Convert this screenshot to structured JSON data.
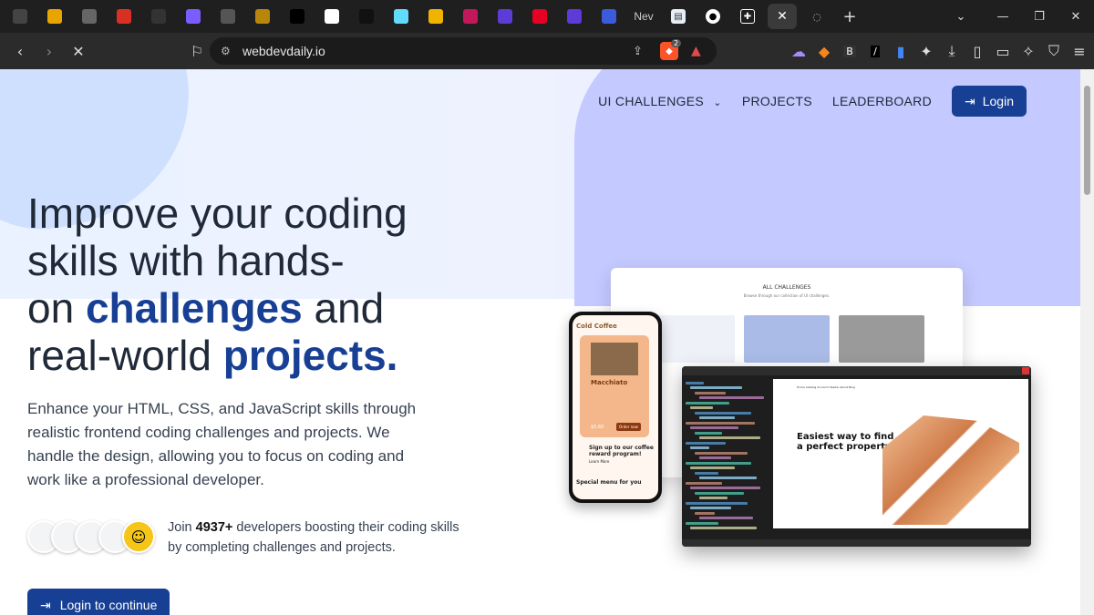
{
  "browser": {
    "tabs": [
      {
        "icon": "cube-icon",
        "color": "#444"
      },
      {
        "icon": "shield-u-icon",
        "color": "#e8a400"
      },
      {
        "icon": "globe-icon",
        "color": "#666"
      },
      {
        "icon": "gmail-icon",
        "color": "#d93025"
      },
      {
        "icon": "info-icon",
        "color": "#333"
      },
      {
        "icon": "e-icon",
        "color": "#7b5cff"
      },
      {
        "icon": "swirl-icon",
        "color": "#555"
      },
      {
        "icon": "x-orange-icon",
        "color": "#b8860b"
      },
      {
        "icon": "x-icon",
        "color": "#000"
      },
      {
        "icon": "record-icon",
        "color": "#fff"
      },
      {
        "icon": "bybt-icon",
        "color": "#111"
      },
      {
        "icon": "react-icon",
        "color": "#61dafb"
      },
      {
        "icon": "medal-icon",
        "color": "#f0b400"
      },
      {
        "icon": "s-icon",
        "color": "#c2185b"
      },
      {
        "icon": "dollar-icon",
        "color": "#5c3bd6"
      },
      {
        "icon": "pinterest-icon",
        "color": "#e60023"
      },
      {
        "icon": "dollar-icon",
        "color": "#5c3bd6"
      },
      {
        "icon": "wave-icon",
        "color": "#3b5bdb"
      }
    ],
    "tab_text": "Nev",
    "url": "webdevdaily.io",
    "new_tab": "+",
    "brave_badge": "2"
  },
  "nav": {
    "challenges": "UI CHALLENGES",
    "projects": "PROJECTS",
    "leaderboard": "LEADERBOARD",
    "login": "Login"
  },
  "hero": {
    "line1": "Improve your coding",
    "line2": "skills with hands-",
    "line3a": "on ",
    "line3b": "challenges",
    "line3c": " and",
    "line4a": "real-world ",
    "line4b": "projects.",
    "description": "Enhance your HTML, CSS, and JavaScript skills through realistic frontend coding challenges and projects. We handle the design, allowing you to focus on coding and work like a professional developer.",
    "join_prefix": "Join ",
    "join_count": "4937+",
    "join_suffix": " developers boosting their coding skills by completing challenges and projects.",
    "cta": "Login to continue"
  },
  "mockup": {
    "all_challenges": "ALL CHALLENGES",
    "all_challenges_sub": "Browse through our collection of UI challenges.",
    "phone_title": "Cold Coffee",
    "phone_item": "Macchiato",
    "phone_price": "$5.60",
    "phone_order": "Order now",
    "phone_banner": "Sign up to our coffee reward program!",
    "phone_learn": "Learn More",
    "phone_menu": "Special menu for you",
    "preview_heading_1": "Easiest way to find",
    "preview_heading_2": "a perfect property",
    "preview_nav": "Home   Catalog   Account   Header   About   Blog"
  }
}
